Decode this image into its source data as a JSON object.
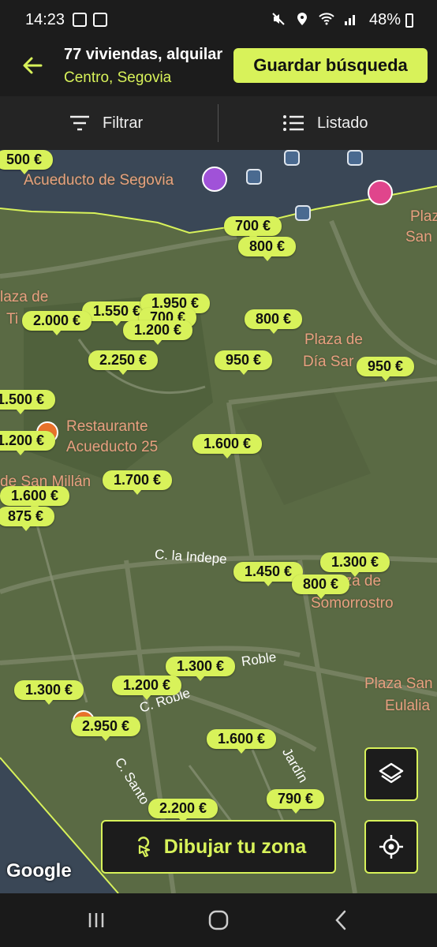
{
  "status": {
    "time": "14:23",
    "battery": "48%"
  },
  "header": {
    "title": "77 viviendas, alquilar",
    "subtitle": "Centro, Segovia",
    "save_label": "Guardar búsqueda"
  },
  "tabs": {
    "filter_label": "Filtrar",
    "list_label": "Listado"
  },
  "map": {
    "places": [
      {
        "text": "Acueducto de Segovia"
      },
      {
        "text": "Plaza de"
      },
      {
        "text": "Día Sar"
      },
      {
        "text": "Plaza"
      },
      {
        "text": "San"
      },
      {
        "text": "laza de"
      },
      {
        "text": "Ti"
      },
      {
        "text": "Restaurante"
      },
      {
        "text": "Acueducto 25"
      },
      {
        "text": "de San Millán"
      },
      {
        "text": "aza de"
      },
      {
        "text": "Somorrostro"
      },
      {
        "text": "Plaza San"
      },
      {
        "text": "Eulalia"
      }
    ],
    "streets": [
      {
        "text": "C. la Indepe"
      },
      {
        "text": "Roble"
      },
      {
        "text": "C. Roble"
      },
      {
        "text": "C. Santo"
      },
      {
        "text": "Jardín"
      }
    ],
    "prices": [
      "500 €",
      "700 €",
      "800 €",
      "1.550 €",
      "1.950 €",
      "700 €",
      "2.000 €",
      "1.200 €",
      "800 €",
      "2.250 €",
      "950 €",
      "950 €",
      "1.500 €",
      "1.200 €",
      "1.600 €",
      "1.700 €",
      "1.600 €",
      "875 €",
      "1.300 €",
      "1.450 €",
      "800 €",
      "1.300 €",
      "1.300 €",
      "1.200 €",
      "2.950 €",
      "1.600 €",
      "790 €",
      "2.200 €"
    ],
    "draw_zone_label": "Dibujar tu zona",
    "google": "Google"
  },
  "colors": {
    "accent": "#d8f25a",
    "map": "#5a6a44",
    "bar": "#1c1c1c"
  }
}
